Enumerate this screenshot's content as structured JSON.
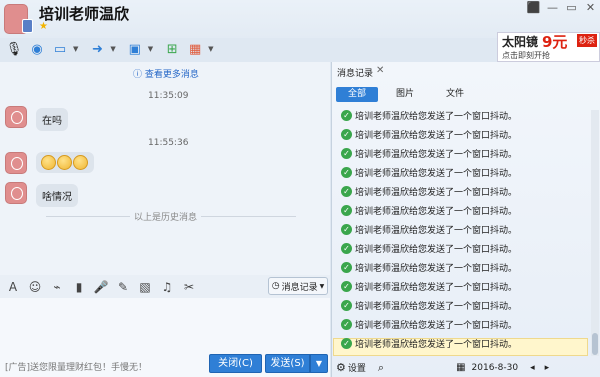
{
  "window": {
    "title": "培训老师温欣",
    "controls": [
      "⬛",
      "—",
      "▭",
      "✕"
    ]
  },
  "toolbar": {
    "icons": [
      "mic-icon",
      "camera-icon",
      "screen-share-icon",
      "file-transfer-icon",
      "remote-desktop-icon",
      "invite-icon",
      "apps-icon"
    ]
  },
  "ad": {
    "brand": "太阳镜",
    "price": "9元",
    "tag": "秒杀",
    "sub": "点击即刻开抢"
  },
  "chat": {
    "more_history": "查看更多消息",
    "messages": [
      {
        "time": "11:35:09",
        "text": "在吗"
      },
      {
        "time": "11:55:36",
        "text": ""
      },
      {
        "time": "",
        "text": "啥情况"
      }
    ],
    "history_divider": "以上是历史消息"
  },
  "input": {
    "msg_record_btn": "消息记录",
    "footer_ad": "[广告]送您限量理财红包！手慢无！",
    "close_btn": "关闭(C)",
    "send_btn": "发送(S)"
  },
  "panel": {
    "title": "消息记录",
    "tabs": [
      "全部",
      "图片",
      "文件"
    ],
    "record_text": "培训老师温欣给您发送了一个窗口抖动。",
    "records_count": 13,
    "settings": "设置",
    "date": "2016-8-30"
  },
  "colors": {
    "accent": "#2f7fd6",
    "check": "#3aa64c",
    "highlight": "#fff6cc"
  }
}
